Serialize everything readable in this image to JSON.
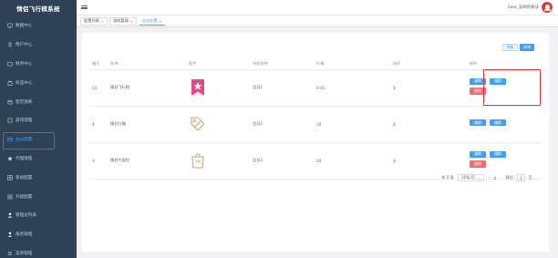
{
  "app": {
    "title": "情侣飞行棋系统"
  },
  "sidebar": {
    "items": [
      {
        "label": "数据中心",
        "icon": "monitor-icon"
      },
      {
        "label": "用户中心",
        "icon": "user-icon"
      },
      {
        "label": "财务中心",
        "icon": "wallet-icon"
      },
      {
        "label": "商品中心",
        "icon": "bag-icon"
      },
      {
        "label": "首页放映",
        "icon": "home-icon"
      },
      {
        "label": "游戏管理",
        "icon": "game-icon"
      },
      {
        "label": "会员配置",
        "icon": "vip-icon"
      },
      {
        "label": "代理管理",
        "icon": "star-icon"
      },
      {
        "label": "系统配置",
        "icon": "grid-icon"
      },
      {
        "label": "升级配置",
        "icon": "upgrade-icon"
      },
      {
        "label": "管理员列表",
        "icon": "admin-icon"
      },
      {
        "label": "角色管理",
        "icon": "role-icon"
      },
      {
        "label": "菜单管理",
        "icon": "menu-icon"
      }
    ],
    "active_index": 6
  },
  "header": {
    "user_text": "2ww_双刷的秘诀"
  },
  "tags": [
    {
      "label": "配置列表"
    },
    {
      "label": "游戏管理"
    },
    {
      "label": "会员配置",
      "active": true
    }
  ],
  "toolbar": {
    "refresh_label": "刷新",
    "add_label": "新增"
  },
  "table": {
    "headers": [
      "编号",
      "名称",
      "图片",
      "特权名称",
      "价格",
      "排序",
      "操作"
    ],
    "rows": [
      {
        "id": "13",
        "name": "情侣飞行棋",
        "image": "star-badge-icon",
        "privilege": "会员1",
        "price": "0.01",
        "sort": "1"
      },
      {
        "id": "4",
        "name": "情侣打趣",
        "image": "tag-icon",
        "privilege": "会员2",
        "price": "10",
        "sort": "2"
      },
      {
        "id": "3",
        "name": "情侣大冒险",
        "image": "shopping-bag-icon",
        "privilege": "会员3",
        "price": "20",
        "sort": "3"
      }
    ],
    "actions": {
      "edit_label": "编辑",
      "detail_label": "编辑",
      "delete_label": "删除"
    }
  },
  "pagination": {
    "total_text": "共 3 条",
    "page_size_text": "10条/页",
    "current_page": "1",
    "goto_label": "前往",
    "goto_value": "1",
    "page_suffix": "页"
  },
  "colors": {
    "sidebar_bg": "#304156",
    "primary": "#409eff",
    "danger": "#f56c6c",
    "highlight": "#e53935",
    "icon_pink": "#e8488a",
    "icon_tan": "#d8b08a"
  }
}
